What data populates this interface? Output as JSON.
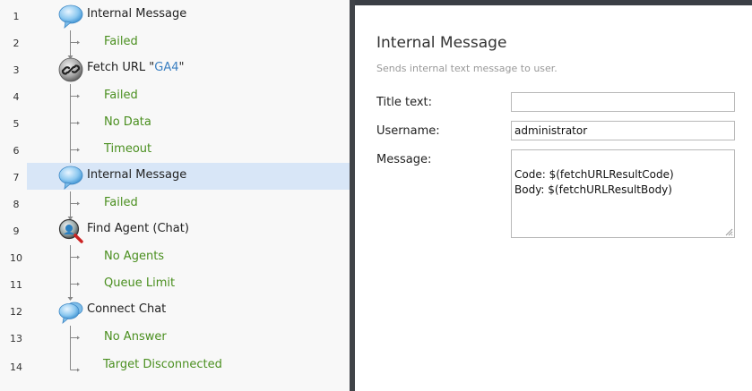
{
  "workflow": {
    "rows": [
      {
        "num": "1",
        "kind": "action",
        "icon": "speech-bubble-icon",
        "label": "Internal Message"
      },
      {
        "num": "2",
        "kind": "outcome",
        "label": "Failed"
      },
      {
        "num": "3",
        "kind": "action",
        "icon": "link-chain-icon",
        "label": "Fetch URL \"",
        "link": "GA4",
        "suffix": "\""
      },
      {
        "num": "4",
        "kind": "outcome",
        "label": "Failed"
      },
      {
        "num": "5",
        "kind": "outcome",
        "label": "No Data"
      },
      {
        "num": "6",
        "kind": "outcome",
        "label": "Timeout"
      },
      {
        "num": "7",
        "kind": "action",
        "icon": "speech-bubble-icon",
        "label": "Internal Message",
        "selected": true
      },
      {
        "num": "8",
        "kind": "outcome",
        "label": "Failed"
      },
      {
        "num": "9",
        "kind": "action",
        "icon": "agent-search-icon",
        "label": "Find Agent (Chat)"
      },
      {
        "num": "10",
        "kind": "outcome",
        "label": "No Agents"
      },
      {
        "num": "11",
        "kind": "outcome",
        "label": "Queue Limit"
      },
      {
        "num": "12",
        "kind": "action",
        "icon": "speech-bubbles-icon",
        "label": "Connect Chat"
      },
      {
        "num": "13",
        "kind": "outcome",
        "label": "No Answer"
      },
      {
        "num": "14",
        "kind": "outcome",
        "label": "Target Disconnected"
      }
    ]
  },
  "properties": {
    "title": "Internal Message",
    "description": "Sends internal text message to user.",
    "title_text_label": "Title text:",
    "title_text_value": "",
    "username_label": "Username:",
    "username_value": "administrator",
    "message_label": "Message:",
    "message_value": "Code: $(fetchURLResultCode)\nBody: $(fetchURLResultBody)"
  },
  "colors": {
    "outcome_text": "#4a8f1f",
    "selected_row": "#d8e6f7",
    "link_text": "#3a7fc1"
  }
}
